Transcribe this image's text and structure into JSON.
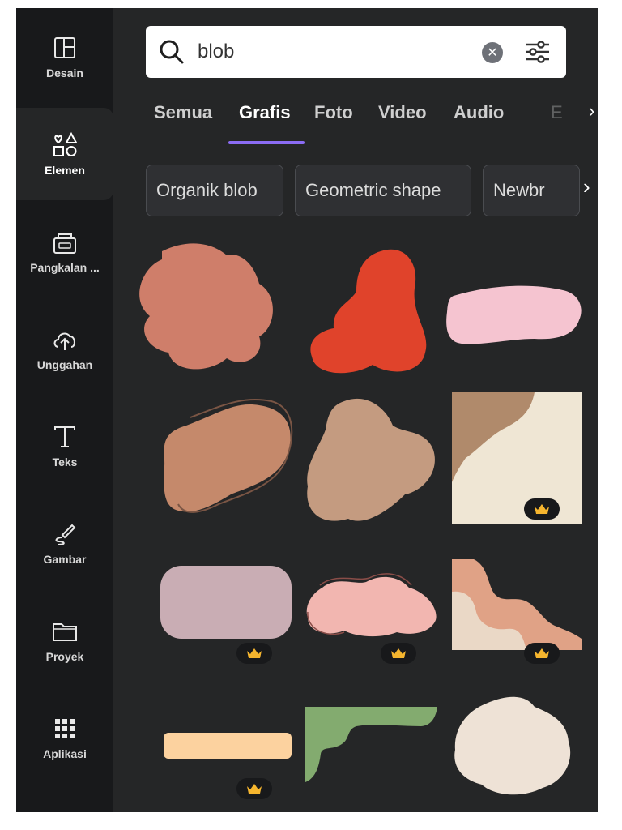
{
  "sidebar": {
    "items": [
      {
        "label": "Desain",
        "icon": "layout-icon",
        "active": false
      },
      {
        "label": "Elemen",
        "icon": "shapes-icon",
        "active": true
      },
      {
        "label": "Pangkalan ...",
        "icon": "brand-kit-icon",
        "active": false
      },
      {
        "label": "Unggahan",
        "icon": "cloud-upload-icon",
        "active": false
      },
      {
        "label": "Teks",
        "icon": "text-icon",
        "active": false
      },
      {
        "label": "Gambar",
        "icon": "draw-icon",
        "active": false
      },
      {
        "label": "Proyek",
        "icon": "folder-icon",
        "active": false
      },
      {
        "label": "Aplikasi",
        "icon": "apps-grid-icon",
        "active": false
      }
    ]
  },
  "search": {
    "value": "blob",
    "clear_icon": "clear-icon",
    "filter_icon": "filter-sliders-icon"
  },
  "tabs": [
    {
      "label": "Semua",
      "active": false
    },
    {
      "label": "Grafis",
      "active": true
    },
    {
      "label": "Foto",
      "active": false
    },
    {
      "label": "Video",
      "active": false
    },
    {
      "label": "Audio",
      "active": false
    }
  ],
  "tabs_more_partial": "E",
  "chips": [
    {
      "label": "Organik blob"
    },
    {
      "label": "Geometric shape"
    },
    {
      "label": "Newbr"
    }
  ],
  "colors": {
    "panel_bg": "#252627",
    "sidebar_bg": "#18191b",
    "accent": "#8b6cf4",
    "crown": "#f5b52e"
  },
  "graphics": [
    {
      "name": "terracotta-blob",
      "color": "#cf7e6a",
      "premium": false
    },
    {
      "name": "red-blob",
      "color": "#e0432b",
      "premium": false
    },
    {
      "name": "pink-wide-blob",
      "color": "#f5c4d0",
      "premium": false
    },
    {
      "name": "tan-outlined-blob",
      "color": "#c5896b",
      "premium": false
    },
    {
      "name": "beige-blob",
      "color": "#c49b80",
      "premium": false
    },
    {
      "name": "corner-wave-brown-cream",
      "color": "#b08a6b",
      "premium": true
    },
    {
      "name": "mauve-rounded-rect",
      "color": "#c9adb4",
      "premium": true
    },
    {
      "name": "pink-cloud-outlined",
      "color": "#f2b6b0",
      "premium": true
    },
    {
      "name": "corner-wave-salmon",
      "color": "#e0a286",
      "premium": true
    },
    {
      "name": "peach-bar",
      "color": "#fcd29f",
      "premium": true
    },
    {
      "name": "green-drip-corner",
      "color": "#83ab6f",
      "premium": false
    },
    {
      "name": "cream-blob",
      "color": "#eee2d6",
      "premium": false
    }
  ]
}
